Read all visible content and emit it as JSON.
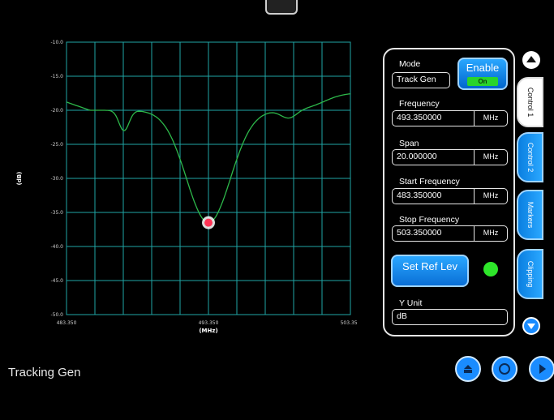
{
  "app_title": "Tracking Gen",
  "graph": {
    "y_axis_label": "(dB)",
    "x_axis_label": "(MHz)",
    "y_ticks": [
      "-10.0",
      "-15.0",
      "-20.0",
      "-25.0",
      "-30.0",
      "-35.0",
      "-40.0",
      "-45.0",
      "-50.0"
    ],
    "x_ticks": [
      "483.350",
      "493.350",
      "503.350"
    ],
    "marker_x_mhz": 493.35,
    "marker_y_db": -36.5,
    "trace_color": "#2db84a",
    "grid_color": "#1fa6a6"
  },
  "panel": {
    "mode_label": "Mode",
    "mode_value": "Track Gen",
    "enable_label": "Enable",
    "enable_state": "On",
    "frequency_label": "Frequency",
    "frequency_value": "493.350000",
    "frequency_unit": "MHz",
    "span_label": "Span",
    "span_value": "20.000000",
    "span_unit": "MHz",
    "start_label": "Start Frequency",
    "start_value": "483.350000",
    "start_unit": "MHz",
    "stop_label": "Stop Frequency",
    "stop_value": "503.350000",
    "stop_unit": "MHz",
    "set_ref_label": "Set Ref Lev",
    "y_unit_label": "Y Unit",
    "y_unit_value": "dB"
  },
  "tabs": [
    "Control 1",
    "Control 2",
    "Markers",
    "Clipping"
  ],
  "colors": {
    "accent": "#1a8cff",
    "led": "#2ee62a",
    "marker": "#ff3355"
  },
  "icons": [
    "scroll-up-icon",
    "scroll-down-icon",
    "home-icon",
    "refresh-icon",
    "next-icon"
  ]
}
